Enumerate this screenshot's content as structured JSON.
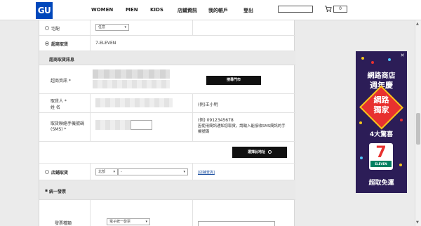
{
  "header": {
    "logo": "GU",
    "nav": [
      "WOMEN",
      "MEN",
      "KIDS",
      "店鋪資訊",
      "我的帳戶",
      "登出"
    ],
    "cart_count": "0"
  },
  "delivery": {
    "home": {
      "label": "宅配",
      "select_value": "任意"
    },
    "store_pickup": {
      "label": "超商取貨",
      "value": "7-ELEVEN"
    },
    "store_info_title": "超商取貨訊息",
    "store_info_label": "超商資訊 *",
    "choose_store_button": "搜尋門市",
    "recipient_label_1": "取貨人 *",
    "recipient_label_2": "姓 名",
    "recipient_example": "(例)王小明",
    "phone_label_1": "取貨聯絡手機號碼",
    "phone_label_2": "(SMS) *",
    "phone_example": "(例) 0912345678",
    "phone_note_1": "因使用簡訊通知您取貨，請輸入能接收SMS簡訊的手",
    "phone_note_2": "機號碼",
    "select_address_button": "選擇此地址",
    "store_pick": {
      "label": "店鋪取貨",
      "region_value": "北部",
      "store_value": "-",
      "link": "[店鋪查詢]"
    }
  },
  "invoice": {
    "title": "統一發票",
    "type_label": "發票種類",
    "type_value": "電子統一發票"
  },
  "ad": {
    "title_1": "網路商店",
    "title_2": "週年慶",
    "badge_1": "網路",
    "badge_2": "獨家",
    "sub": "4大驚喜",
    "logo_number": "7",
    "logo_text": "ELEVEN",
    "bottom": "超取免運",
    "colors": {
      "background": "#2c1d57",
      "badge": "#e8312f",
      "accent": "#f4c51c"
    }
  },
  "colors": {
    "brand": "#0047bb",
    "button": "#111111",
    "link": "#1a4ea0"
  }
}
